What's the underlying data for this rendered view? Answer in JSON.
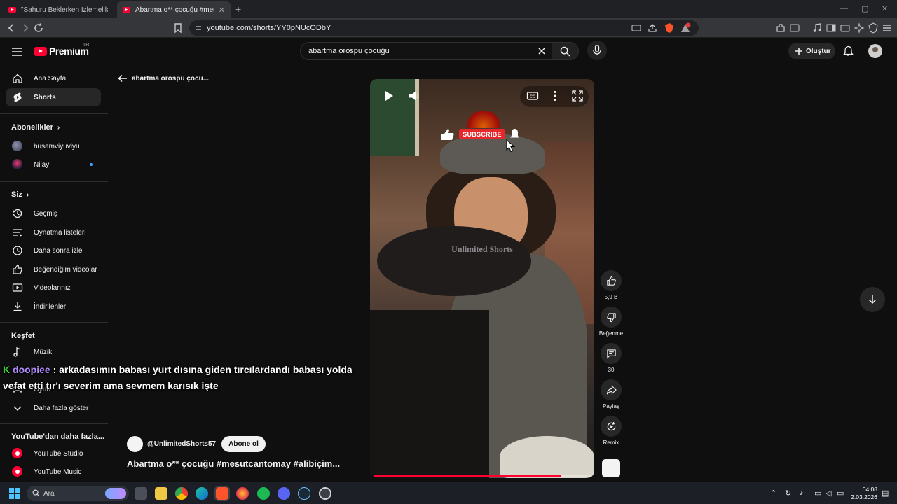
{
  "browser": {
    "tabs": [
      {
        "title": "\"Sahuru Beklerken İzlemelik Edit\" Kis",
        "active": false
      },
      {
        "title": "Abartma o** çocuğu #mesutcan",
        "active": true
      }
    ],
    "url": "youtube.com/shorts/YY0pNUcODbY"
  },
  "masthead": {
    "brand": "Premium",
    "country": "TR",
    "search_value": "abartma orospu çocuğu",
    "create_label": "Oluştur"
  },
  "sidebar": {
    "primary": [
      {
        "label": "Ana Sayfa",
        "icon": "home-icon"
      },
      {
        "label": "Shorts",
        "icon": "shorts-icon",
        "active": true
      }
    ],
    "subscriptions_heading": "Abonelikler",
    "subscriptions": [
      {
        "label": "husamviyuviyu"
      },
      {
        "label": "Nilay",
        "live": true
      }
    ],
    "you_heading": "Siz",
    "you_items": [
      {
        "label": "Geçmiş",
        "icon": "history-icon"
      },
      {
        "label": "Oynatma listeleri",
        "icon": "playlist-icon"
      },
      {
        "label": "Daha sonra izle",
        "icon": "clock-icon"
      },
      {
        "label": "Beğendiğim videolar",
        "icon": "thumb-up-icon"
      },
      {
        "label": "Videolarınız",
        "icon": "your-videos-icon"
      },
      {
        "label": "İndirilenler",
        "icon": "download-icon"
      }
    ],
    "explore_heading": "Keşfet",
    "explore_items": [
      {
        "label": "Müzik",
        "icon": "music-icon"
      },
      {
        "label": "Oyun",
        "icon": "gaming-icon"
      }
    ],
    "show_more": "Daha fazla göster",
    "more_heading": "YouTube'dan daha fazla...",
    "more_items": [
      {
        "label": "YouTube Studio"
      },
      {
        "label": "YouTube Music"
      }
    ]
  },
  "main": {
    "back_label": "abartma orospu çocu...",
    "video": {
      "watermark": "Unlimited Shorts",
      "subscribe_banner": "SUBSCRIBE",
      "progress": 0.86
    },
    "actions": [
      {
        "label": "5,9 B",
        "icon": "like-icon"
      },
      {
        "label": "Beğenme",
        "icon": "dislike-icon"
      },
      {
        "label": "30",
        "icon": "comment-icon"
      },
      {
        "label": "Paylaş",
        "icon": "share-icon"
      },
      {
        "label": "Remix",
        "icon": "remix-icon"
      }
    ],
    "channel": "@UnlimitedShorts57",
    "subscribe_label": "Abone ol",
    "title": "Abartma o** çocuğu #mesutcantomay #alibiçim..."
  },
  "chat_overlay": {
    "prefix": "K",
    "username": "doopiee",
    "message": " : arkadasımın babası yurt dısına giden tırcılardandı babası yolda vefat etti tır'ı severim ama sevmem karısık işte"
  },
  "taskbar": {
    "search_placeholder": "Ara",
    "time": "04:08",
    "date": "2.03.2026"
  },
  "colors": {
    "youtube_red": "#ff0033",
    "background": "#0f0f0f",
    "chip": "#272727",
    "chat_user": "#b28cff",
    "chat_k": "#3ad93a"
  }
}
